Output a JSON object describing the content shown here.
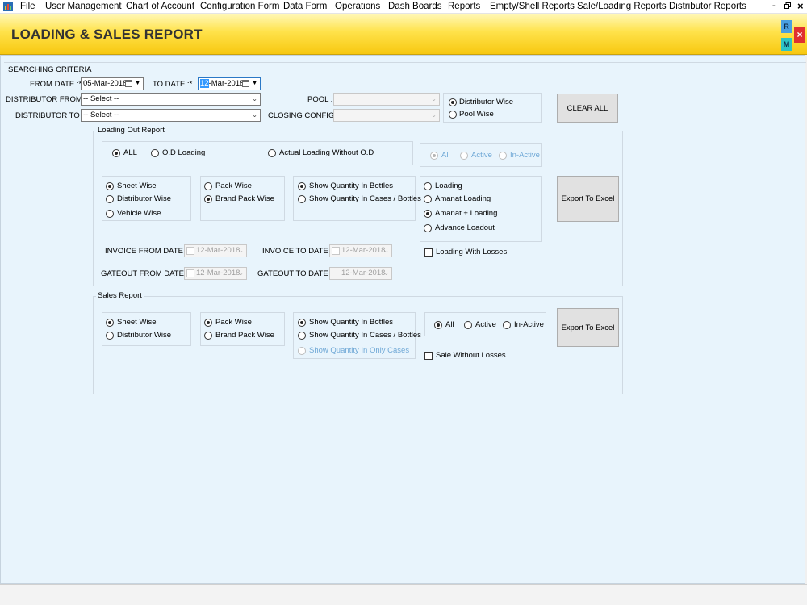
{
  "menubar": {
    "items": [
      "File",
      "User Management",
      "Chart of Account",
      "Configuration Form",
      "Data Form",
      "Operations",
      "Dash Boards",
      "Reports",
      "Empty/Shell Reports",
      "Sale/Loading Reports",
      "Distributor Reports"
    ],
    "minimize": "-",
    "restore": "ȱ",
    "close": "×"
  },
  "header": {
    "title": "LOADING & SALES REPORT",
    "badge_r": "R",
    "badge_m": "M",
    "badge_x": "×"
  },
  "search": {
    "section_title": "SEARCHING CRITERIA",
    "from_date_label": "FROM DATE :*",
    "from_date_value": "05-Mar-2018",
    "to_date_label": "TO DATE :*",
    "to_date_sel": "12",
    "to_date_rest": "-Mar-2018",
    "distributor_from_label": "DISTRIBUTOR FROM :",
    "distributor_from_value": "-- Select --",
    "distributor_to_label": "DISTRIBUTOR TO :",
    "distributor_to_value": "-- Select --",
    "pool_label": "POOL :",
    "closing_config_label": "CLOSING CONFIG :",
    "distributor_wise": "Distributor Wise",
    "pool_wise": "Pool Wise",
    "clear_all": "CLEAR ALL"
  },
  "loading_out": {
    "legend": "Loading Out Report",
    "type_all": "ALL",
    "type_od": "O.D Loading",
    "type_actual": "Actual Loading Without O.D",
    "status_all": "All",
    "status_active": "Active",
    "status_inactive": "In-Active",
    "sheet_wise": "Sheet Wise",
    "distributor_wise": "Distributor Wise",
    "vehicle_wise": "Vehicle Wise",
    "pack_wise": "Pack Wise",
    "brand_pack_wise": "Brand Pack Wise",
    "qty_bottles": "Show Quantity In Bottles",
    "qty_cases": "Show Quantity In Cases / Bottles",
    "loading": "Loading",
    "amanat_loading": "Amanat Loading",
    "amanat_plus_loading": "Amanat + Loading",
    "advance_loadout": "Advance Loadout",
    "loading_with_losses": "Loading With Losses",
    "export": "Export To Excel",
    "invoice_from_label": "INVOICE FROM DATE :",
    "invoice_from_value": "12-Mar-2018",
    "invoice_to_label": "INVOICE TO DATE :",
    "invoice_to_value": "12-Mar-2018",
    "gateout_from_label": "GATEOUT FROM DATE :",
    "gateout_from_value": "12-Mar-2018",
    "gateout_to_label": "GATEOUT TO DATE :",
    "gateout_to_value": "12-Mar-2018"
  },
  "sales": {
    "legend": "Sales Report",
    "sheet_wise": "Sheet Wise",
    "distributor_wise": "Distributor Wise",
    "pack_wise": "Pack Wise",
    "brand_pack_wise": "Brand Pack Wise",
    "qty_bottles": "Show Quantity In Bottles",
    "qty_cases": "Show Quantity In Cases / Bottles",
    "qty_only_cases": "Show Quantity In Only Cases",
    "status_all": "All",
    "status_active": "Active",
    "status_inactive": "In-Active",
    "sale_without_losses": "Sale Without Losses",
    "export": "Export To Excel"
  },
  "colors": {
    "header_yellow": "#ffe24a",
    "content_bg": "#e8f4fc",
    "badge_r": "#4a9fe0",
    "badge_m": "#2ec4c4",
    "badge_x": "#e03030"
  }
}
